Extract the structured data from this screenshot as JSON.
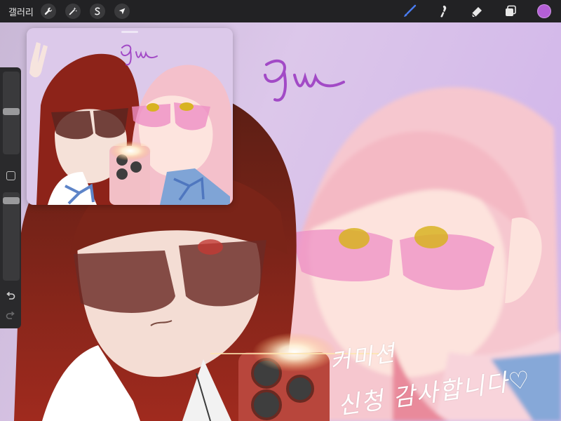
{
  "toolbar": {
    "gallery_label": "갤러리",
    "left_tools": [
      {
        "name": "actions",
        "icon": "wrench-icon"
      },
      {
        "name": "adjustments",
        "icon": "magic-wand-icon"
      },
      {
        "name": "selection",
        "icon": "selection-s-icon"
      },
      {
        "name": "transform",
        "icon": "arrow-cursor-icon"
      }
    ],
    "right_tools": [
      {
        "name": "brush",
        "icon": "brush-icon",
        "active": true
      },
      {
        "name": "smudge",
        "icon": "smudge-icon"
      },
      {
        "name": "eraser",
        "icon": "eraser-icon"
      },
      {
        "name": "layers",
        "icon": "layers-icon"
      }
    ],
    "current_color": "#b45fd6",
    "active_color": "#4a7cf0"
  },
  "sidebar": {
    "brush_size": 0.52,
    "opacity": 0.06
  },
  "artwork": {
    "signature": "Gyu",
    "handwriting_line1": "커미션",
    "handwriting_line2": "신청 감사합니다♡",
    "background_color": "#d9c4ea"
  }
}
